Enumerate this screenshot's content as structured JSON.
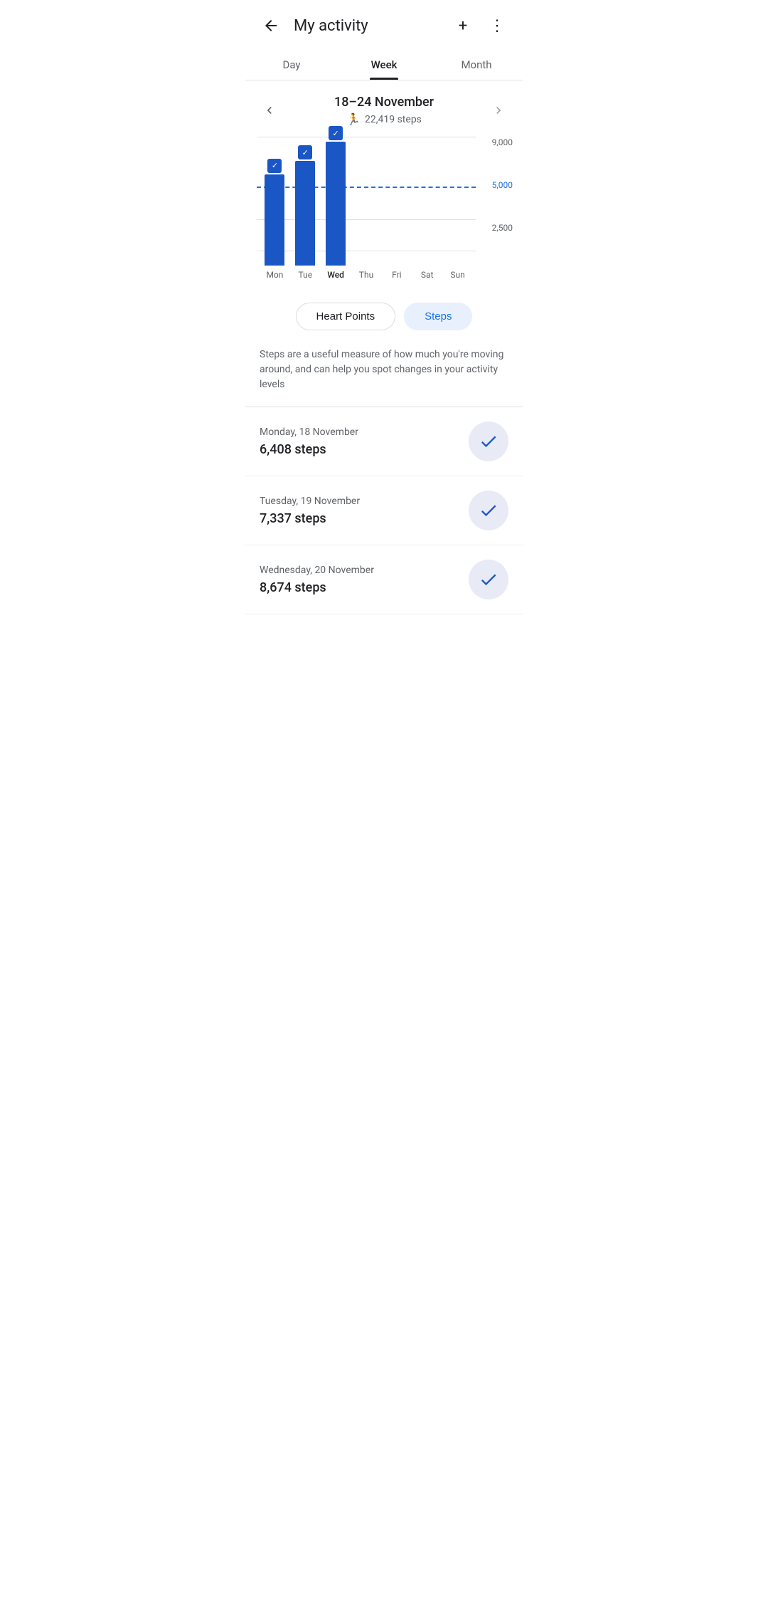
{
  "header": {
    "title": "My activity",
    "back_label": "←",
    "add_label": "+",
    "more_label": "⋮"
  },
  "tabs": [
    {
      "label": "Day",
      "active": false
    },
    {
      "label": "Week",
      "active": true
    },
    {
      "label": "Month",
      "active": false
    }
  ],
  "week": {
    "title": "18–24 November",
    "total_steps": "22,419 steps"
  },
  "chart": {
    "y_labels": [
      "9,000",
      "5,000",
      "2,500"
    ],
    "goal_value": 5000,
    "max_value": 9000,
    "bars": [
      {
        "day": "Mon",
        "steps": 6408,
        "has_check": true,
        "active": false
      },
      {
        "day": "Tue",
        "steps": 7337,
        "has_check": true,
        "active": false
      },
      {
        "day": "Wed",
        "steps": 8674,
        "has_check": true,
        "active": true
      },
      {
        "day": "Thu",
        "steps": 0,
        "has_check": false,
        "active": false
      },
      {
        "day": "Fri",
        "steps": 0,
        "has_check": false,
        "active": false
      },
      {
        "day": "Sat",
        "steps": 0,
        "has_check": false,
        "active": false
      },
      {
        "day": "Sun",
        "steps": 0,
        "has_check": false,
        "active": false
      }
    ]
  },
  "toggle": {
    "options": [
      {
        "label": "Heart Points",
        "active": false
      },
      {
        "label": "Steps",
        "active": true
      }
    ]
  },
  "description": "Steps are a useful measure of how much you're moving around, and can help you spot changes in your activity levels",
  "day_entries": [
    {
      "date": "Monday, 18 November",
      "steps": "6,408 steps"
    },
    {
      "date": "Tuesday, 19 November",
      "steps": "7,337 steps"
    },
    {
      "date": "Wednesday, 20 November",
      "steps": "8,674 steps"
    }
  ]
}
